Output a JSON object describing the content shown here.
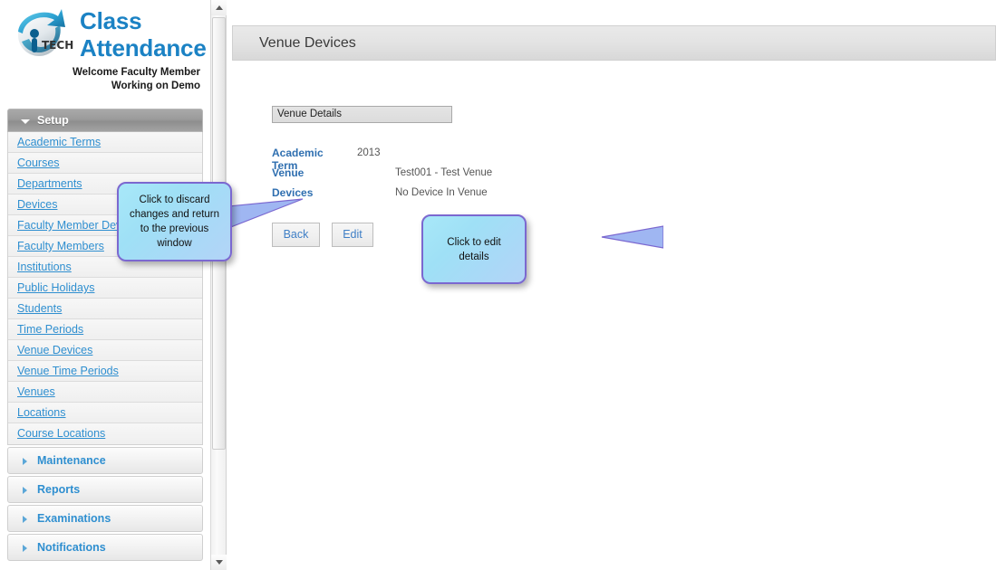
{
  "brand": {
    "logo_icon": "ip-tech-globe-logo",
    "title_line1": "Class",
    "title_line2": "Attendance",
    "welcome_line1": "Welcome Faculty Member",
    "welcome_line2": "Working on Demo"
  },
  "sidebar": {
    "sections": [
      {
        "label": "Setup",
        "state": "expanded",
        "icon": "chevron-down-icon",
        "items": [
          {
            "label": "Academic Terms"
          },
          {
            "label": "Courses"
          },
          {
            "label": "Departments"
          },
          {
            "label": "Devices"
          },
          {
            "label": "Faculty Member Devices"
          },
          {
            "label": "Faculty Members"
          },
          {
            "label": "Institutions"
          },
          {
            "label": "Public Holidays"
          },
          {
            "label": "Students"
          },
          {
            "label": "Time Periods"
          },
          {
            "label": "Venue Devices"
          },
          {
            "label": "Venue Time Periods"
          },
          {
            "label": "Venues"
          },
          {
            "label": "Locations"
          },
          {
            "label": "Course Locations"
          }
        ]
      },
      {
        "label": "Maintenance",
        "state": "collapsed",
        "icon": "chevron-right-icon",
        "items": []
      },
      {
        "label": "Reports",
        "state": "collapsed",
        "icon": "chevron-right-icon",
        "items": []
      },
      {
        "label": "Examinations",
        "state": "collapsed",
        "icon": "chevron-right-icon",
        "items": []
      },
      {
        "label": "Notifications",
        "state": "collapsed",
        "icon": "chevron-right-icon",
        "items": []
      }
    ]
  },
  "scrollbar": {
    "up_icon": "triangle-up-icon",
    "down_icon": "triangle-down-icon"
  },
  "main": {
    "page_title": "Venue Devices",
    "panel_header": "Venue Details",
    "fields": [
      {
        "label": "Academic Term",
        "value": "2013"
      },
      {
        "label": "Venue",
        "value": "Test001 - Test Venue"
      },
      {
        "label": "Devices",
        "value": "No Device In Venue"
      }
    ],
    "buttons": {
      "back": "Back",
      "edit": "Edit"
    }
  },
  "callouts": [
    {
      "id": "back",
      "text": "Click to discard changes and return to the previous window"
    },
    {
      "id": "edit",
      "text": "Click to edit details"
    }
  ],
  "colors": {
    "brand_blue": "#1b82c4",
    "link_blue": "#2f8fd0",
    "label_blue": "#2f6fb0",
    "button_text": "#3f7fc6",
    "callout_border": "#7b68d0",
    "callout_fill": "#a8e8f8",
    "section_head_grey": "#9b9b9b"
  }
}
